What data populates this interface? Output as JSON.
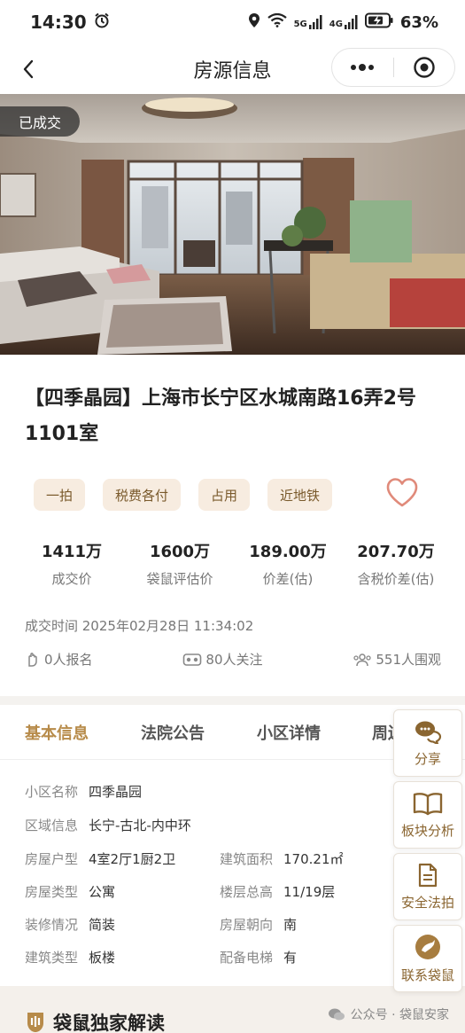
{
  "status": {
    "time": "14:30",
    "battery": "63%",
    "net5g": "5G",
    "net4g": "4G"
  },
  "nav": {
    "title": "房源信息"
  },
  "badge": "已成交",
  "title": "【四季晶园】上海市长宁区水城南路16弄2号1101室",
  "tags": [
    "一拍",
    "税费各付",
    "占用",
    "近地铁"
  ],
  "stats": [
    {
      "value": "1411万",
      "label": "成交价"
    },
    {
      "value": "1600万",
      "label": "袋鼠评估价"
    },
    {
      "value": "189.00万",
      "label": "价差(估)"
    },
    {
      "value": "207.70万",
      "label": "含税价差(估)"
    }
  ],
  "deal_time": "成交时间 2025年02月28日 11:34:02",
  "counts": {
    "signup": "0人报名",
    "follow": "80人关注",
    "view": "551人围观"
  },
  "tabs": [
    "基本信息",
    "法院公告",
    "小区详情",
    "周边"
  ],
  "info": {
    "community": {
      "k": "小区名称",
      "v": "四季晶园"
    },
    "region": {
      "k": "区域信息",
      "v": "长宁-古北-内中环"
    },
    "layout": {
      "k": "房屋户型",
      "v": "4室2厅1厨2卫"
    },
    "area": {
      "k": "建筑面积",
      "v": "170.21㎡"
    },
    "house_type": {
      "k": "房屋类型",
      "v": "公寓"
    },
    "floor": {
      "k": "楼层总高",
      "v": "11/19层"
    },
    "decoration": {
      "k": "装修情况",
      "v": "简装"
    },
    "orientation": {
      "k": "房屋朝向",
      "v": "南"
    },
    "building": {
      "k": "建筑类型",
      "v": "板楼"
    },
    "elevator": {
      "k": "配备电梯",
      "v": "有"
    }
  },
  "floating": {
    "share": "分享",
    "analysis": "板块分析",
    "safe": "安全法拍",
    "contact": "联系袋鼠"
  },
  "exclusive": "袋鼠独家解读",
  "wechat": "公众号 · 袋鼠安家",
  "colors": {
    "accent": "#b78b4a",
    "tag_bg": "#f7ece0",
    "heart": "#e08a7a"
  }
}
